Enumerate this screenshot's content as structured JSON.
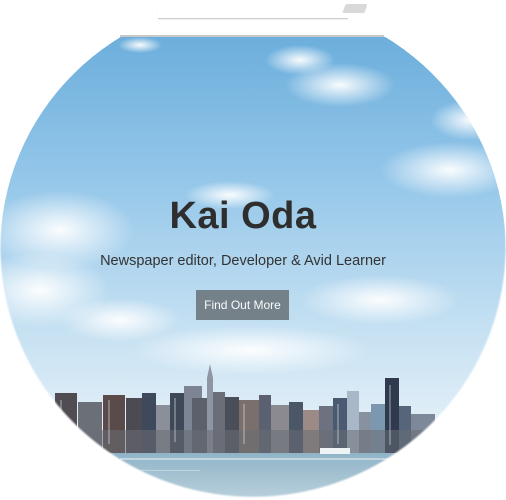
{
  "hero": {
    "title": "Kai Oda",
    "subtitle": "Newspaper editor, Developer & Avid Learner",
    "cta_label": "Find Out More",
    "background_description_icon": "city-skyline-image"
  },
  "colors": {
    "sky_top": "#6fb0dc",
    "sky_mid": "#a9d2ee",
    "sky_bottom": "#dcebf5",
    "water": "#8fb3c8",
    "button_bg": "#6e7a80",
    "title_text": "#2e2e2e"
  }
}
